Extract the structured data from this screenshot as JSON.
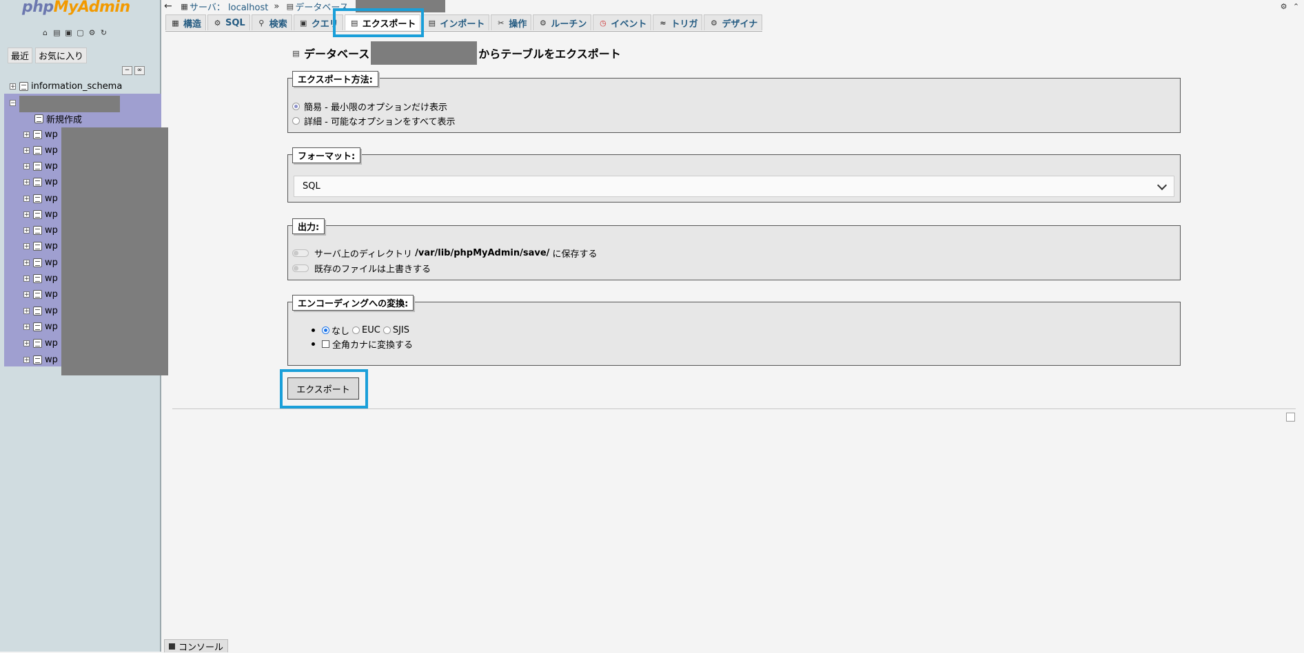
{
  "nav": {
    "logo_php": "php",
    "logo_admin": "MyAdmin",
    "icons": [
      "home-icon",
      "sql-query-icon",
      "docs-icon",
      "help-icon",
      "settings-icon",
      "reload-icon"
    ],
    "recent_label": "最近",
    "favorites_label": "お気に入り",
    "tree": {
      "info_schema": "information_schema",
      "new_item": "新規作成",
      "table_prefix": "wp"
    }
  },
  "breadcrumb": {
    "server_label": "サーバ： localhost",
    "database_label": "データベース"
  },
  "tabs": [
    {
      "label": "構造",
      "icon": "structure-icon"
    },
    {
      "label": "SQL",
      "icon": "sql-icon"
    },
    {
      "label": "検索",
      "icon": "search-icon"
    },
    {
      "label": "クエリ",
      "icon": "query-icon"
    },
    {
      "label": "エクスポート",
      "icon": "export-icon",
      "active": true
    },
    {
      "label": "インポート",
      "icon": "import-icon"
    },
    {
      "label": "操作",
      "icon": "operations-icon"
    },
    {
      "label": "ルーチン",
      "icon": "routines-icon"
    },
    {
      "label": "イベント",
      "icon": "events-icon"
    },
    {
      "label": "トリガ",
      "icon": "triggers-icon"
    },
    {
      "label": "デザイナ",
      "icon": "designer-icon"
    }
  ],
  "main": {
    "title_prefix": "データベース",
    "title_suffix": "からテーブルをエクスポート",
    "export_method": {
      "legend": "エクスポート方法:",
      "option_quick": "簡易 - 最小限のオプションだけ表示",
      "option_custom": "詳細 - 可能なオプションをすべて表示"
    },
    "format": {
      "legend": "フォーマット:",
      "selected": "SQL"
    },
    "output": {
      "legend": "出力:",
      "save_prefix": "サーバ上のディレクトリ ",
      "save_path": "/var/lib/phpMyAdmin/save/",
      "save_suffix": " に保存する",
      "overwrite": "既存のファイルは上書きする"
    },
    "encoding": {
      "legend": "エンコーディングへの変換:",
      "none": "なし",
      "euc": "EUC",
      "sjis": "SJIS",
      "kana": "全角カナに変換する"
    },
    "export_button": "エクスポート"
  },
  "console": {
    "label": "コンソール"
  }
}
